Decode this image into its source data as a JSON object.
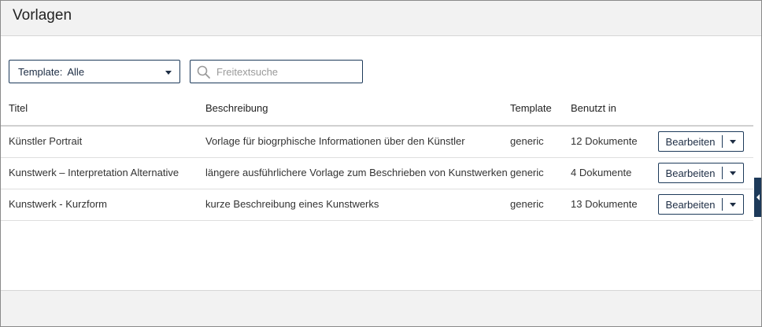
{
  "header": {
    "title": "Vorlagen"
  },
  "filter": {
    "label": "Template:",
    "value": "Alle"
  },
  "search": {
    "placeholder": "Freitextsuche"
  },
  "table": {
    "columns": [
      "Titel",
      "Beschreibung",
      "Template",
      "Benutzt in"
    ],
    "rows": [
      {
        "title": "Künstler Portrait",
        "description": "Vorlage für biogrphische Informationen über den Künstler",
        "template": "generic",
        "used_in": "12 Dokumente"
      },
      {
        "title": "Kunstwerk – Interpretation Alternative",
        "description": "längere ausführlichere Vorlage zum Beschrieben von Kunstwerken",
        "template": "generic",
        "used_in": "4 Dokumente"
      },
      {
        "title": "Kunstwerk - Kurzform",
        "description": "kurze Beschreibung eines Kunstwerks",
        "template": "generic",
        "used_in": "13 Dokumente"
      }
    ],
    "edit_label": "Bearbeiten"
  },
  "colors": {
    "accent": "#1d3a5a",
    "header_bg": "#f2f2f2"
  }
}
